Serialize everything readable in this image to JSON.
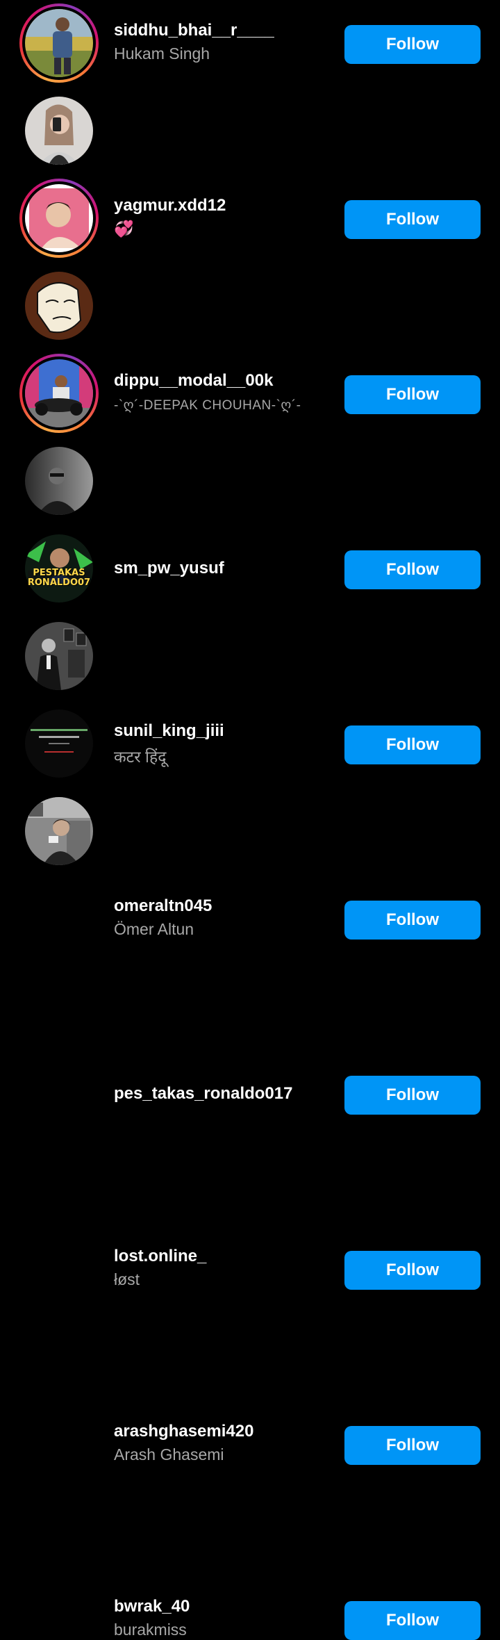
{
  "follow_button_label": "Follow",
  "colors": {
    "background": "#000000",
    "button": "#0095f6",
    "username": "#ffffff",
    "subtitle": "#a8a8a8"
  },
  "accounts": [
    {
      "username": "siddhu_bhai__r____",
      "subtitle": "Hukam Singh",
      "has_story": true
    },
    {
      "username": "yagmur.xdd12",
      "subtitle": "💞",
      "has_story": false
    },
    {
      "username": "dippu__modal__00k",
      "subtitle": "-`ღ´-DEEPAK CHOUHAN-`ღ´-",
      "has_story": true
    },
    {
      "username": "sm_pw_yusuf",
      "subtitle": "",
      "has_story": false
    },
    {
      "username": "sunil_king_jiii",
      "subtitle": "कटर हिंदू",
      "has_story": true
    },
    {
      "username": "omeraltn045",
      "subtitle": "Ömer Altun",
      "has_story": false
    },
    {
      "username": "pes_takas_ronaldo017",
      "subtitle": "",
      "has_story": false,
      "avatar_text": "PESTAKAS RONALDO07"
    },
    {
      "username": "lost.online_",
      "subtitle": "łøst",
      "has_story": false
    },
    {
      "username": "arashghasemi420",
      "subtitle": "Arash Ghasemi",
      "has_story": false
    },
    {
      "username": "bwrak_40",
      "subtitle": "burakmiss",
      "has_story": false
    }
  ]
}
